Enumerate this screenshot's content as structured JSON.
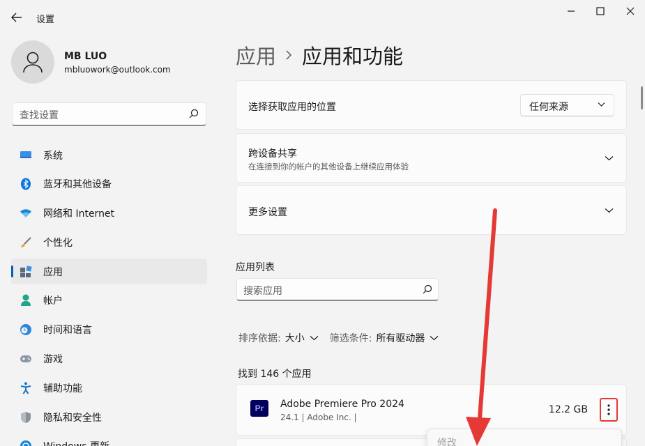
{
  "titlebar": {
    "title": "设置"
  },
  "profile": {
    "name": "MB LUO",
    "email": "mbluowork@outlook.com"
  },
  "search": {
    "placeholder": "查找设置"
  },
  "nav": {
    "items": [
      {
        "label": "系统",
        "icon": "monitor-icon",
        "active": false
      },
      {
        "label": "蓝牙和其他设备",
        "icon": "bluetooth-icon",
        "active": false
      },
      {
        "label": "网络和 Internet",
        "icon": "wifi-icon",
        "active": false
      },
      {
        "label": "个性化",
        "icon": "brush-icon",
        "active": false
      },
      {
        "label": "应用",
        "icon": "apps-icon",
        "active": true
      },
      {
        "label": "帐户",
        "icon": "account-icon",
        "active": false
      },
      {
        "label": "时间和语言",
        "icon": "globe-clock-icon",
        "active": false
      },
      {
        "label": "游戏",
        "icon": "gamepad-icon",
        "active": false
      },
      {
        "label": "辅助功能",
        "icon": "accessibility-icon",
        "active": false
      },
      {
        "label": "隐私和安全性",
        "icon": "shield-icon",
        "active": false
      },
      {
        "label": "Windows 更新",
        "icon": "update-icon",
        "active": false
      }
    ]
  },
  "breadcrumb": {
    "parent": "应用",
    "current": "应用和功能"
  },
  "cards": {
    "install_source": {
      "title": "选择获取应用的位置",
      "dropdown_value": "任何来源"
    },
    "share": {
      "title": "跨设备共享",
      "subtitle": "在连接到你的帐户的其他设备上继续应用体验"
    },
    "more": {
      "title": "更多设置"
    }
  },
  "app_list": {
    "section_label": "应用列表",
    "search_placeholder": "搜索应用",
    "sort_label": "排序依据:",
    "sort_value": "大小",
    "filter_label": "筛选条件:",
    "filter_value": "所有驱动器",
    "found_text": "找到 146 个应用",
    "apps": [
      {
        "name": "Adobe Premiere Pro 2024",
        "meta": "24.1  |  Adobe Inc.  |",
        "size": "12.2 GB",
        "icon_text": "Pr"
      }
    ]
  },
  "context_menu": {
    "item": "修改"
  },
  "colors": {
    "accent": "#005fb8",
    "highlight": "#e53935",
    "premiere_bg": "#00005b"
  }
}
